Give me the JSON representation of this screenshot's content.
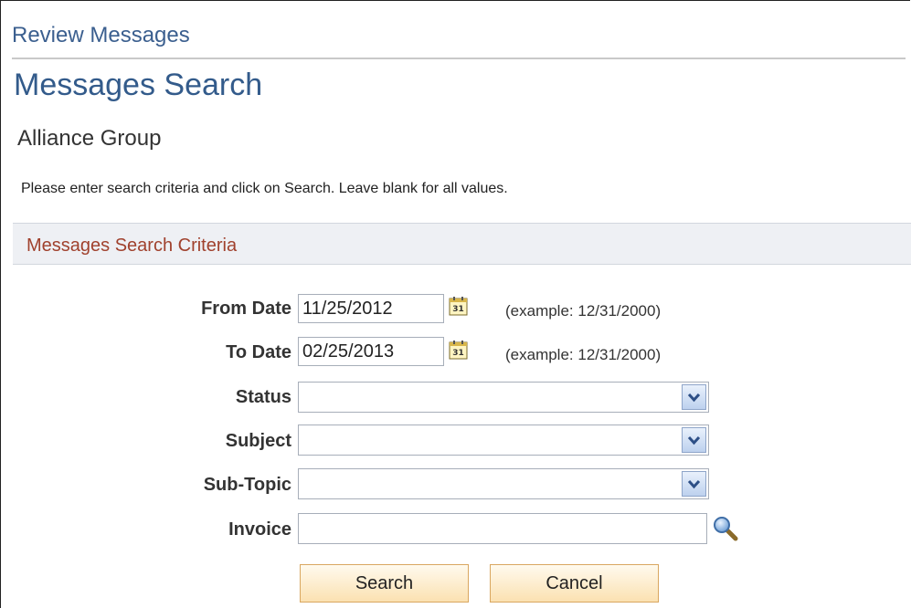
{
  "breadcrumb": "Review Messages",
  "page_title": "Messages Search",
  "subtitle": "Alliance Group",
  "instructions": "Please enter search criteria and click on Search. Leave blank for all values.",
  "section": {
    "title": "Messages Search Criteria"
  },
  "form": {
    "from_date": {
      "label": "From Date",
      "value": "11/25/2012",
      "example": "(example: 12/31/2000)",
      "icon": "calendar-icon"
    },
    "to_date": {
      "label": "To Date",
      "value": "02/25/2013",
      "example": "(example: 12/31/2000)",
      "icon": "calendar-icon"
    },
    "status": {
      "label": "Status",
      "value": ""
    },
    "subject": {
      "label": "Subject",
      "value": ""
    },
    "sub_topic": {
      "label": "Sub-Topic",
      "value": ""
    },
    "invoice": {
      "label": "Invoice",
      "value": "",
      "icon": "magnifier-lookup-icon"
    }
  },
  "buttons": {
    "search": "Search",
    "cancel": "Cancel"
  },
  "colors": {
    "title": "#335b8b",
    "section_title": "#a0412d",
    "section_bg": "#eef0f4",
    "button_bg": "#fbe1b1",
    "button_border": "#d9a760"
  },
  "calendar_icon_text": "31"
}
